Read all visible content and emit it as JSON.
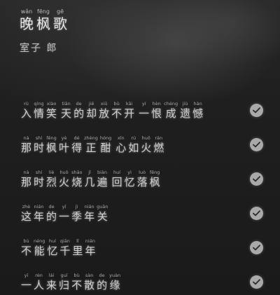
{
  "poem": {
    "title": [
      {
        "py": "wǎn",
        "hz": "晚"
      },
      {
        "py": "fēng",
        "hz": "枫"
      },
      {
        "py": "gē",
        "hz": "歌"
      }
    ],
    "author": "室子 郎",
    "lines": [
      {
        "chars": [
          {
            "py": "rù",
            "hz": "入"
          },
          {
            "py": "qíng",
            "hz": "情"
          },
          {
            "py": "xiào",
            "hz": "笑"
          },
          {
            "py": "",
            "hz": " "
          },
          {
            "py": "tiān",
            "hz": "天"
          },
          {
            "py": "de",
            "hz": "的"
          },
          {
            "py": "jiē",
            "hz": "却"
          },
          {
            "py": "xiū",
            "hz": "放"
          },
          {
            "py": "bù",
            "hz": "不"
          },
          {
            "py": "kāi",
            "hz": "开"
          },
          {
            "py": "",
            "hz": " "
          },
          {
            "py": "yí",
            "hz": "一"
          },
          {
            "py": "hèn",
            "hz": "恨"
          },
          {
            "py": "chéng",
            "hz": "成"
          },
          {
            "py": "jiù",
            "hz": "遗"
          },
          {
            "py": "hàn",
            "hz": "憾"
          }
        ]
      },
      {
        "chars": [
          {
            "py": "nà",
            "hz": "那"
          },
          {
            "py": "shí",
            "hz": "时"
          },
          {
            "py": "fēng",
            "hz": "枫"
          },
          {
            "py": "yè",
            "hz": "叶"
          },
          {
            "py": "dé",
            "hz": "得"
          },
          {
            "py": "zhèng",
            "hz": "正"
          },
          {
            "py": "hóng",
            "hz": "酣"
          },
          {
            "py": "",
            "hz": " "
          },
          {
            "py": "xīn",
            "hz": "心"
          },
          {
            "py": "rú",
            "hz": "如"
          },
          {
            "py": "huǒ",
            "hz": "火"
          },
          {
            "py": "rán",
            "hz": "燃"
          }
        ]
      },
      {
        "chars": [
          {
            "py": "nà",
            "hz": "那"
          },
          {
            "py": "shí",
            "hz": "时"
          },
          {
            "py": "liè",
            "hz": "烈"
          },
          {
            "py": "huǒ",
            "hz": "火"
          },
          {
            "py": "shāo",
            "hz": "烧"
          },
          {
            "py": "jǐ",
            "hz": "几"
          },
          {
            "py": "biàn",
            "hz": "遍"
          },
          {
            "py": "",
            "hz": " "
          },
          {
            "py": "huí",
            "hz": "回"
          },
          {
            "py": "yì",
            "hz": "忆"
          },
          {
            "py": "luò",
            "hz": "落"
          },
          {
            "py": "fēng",
            "hz": "枫"
          }
        ]
      },
      {
        "chars": [
          {
            "py": "zhè",
            "hz": "这"
          },
          {
            "py": "nián",
            "hz": "年"
          },
          {
            "py": "de",
            "hz": "的"
          },
          {
            "py": "yī",
            "hz": "一"
          },
          {
            "py": "jì",
            "hz": "季"
          },
          {
            "py": "nián",
            "hz": "年"
          },
          {
            "py": "guān",
            "hz": "关"
          }
        ]
      },
      {
        "chars": [
          {
            "py": "bù",
            "hz": "不"
          },
          {
            "py": "néng",
            "hz": "能"
          },
          {
            "py": "huí",
            "hz": "忆"
          },
          {
            "py": "qiān",
            "hz": "千"
          },
          {
            "py": "lǐ",
            "hz": "里"
          },
          {
            "py": "nián",
            "hz": "年"
          }
        ]
      },
      {
        "chars": [
          {
            "py": "yī",
            "hz": "一"
          },
          {
            "py": "rén",
            "hz": "人"
          },
          {
            "py": "lái",
            "hz": "来"
          },
          {
            "py": "guī",
            "hz": "归"
          },
          {
            "py": "bù",
            "hz": "不"
          },
          {
            "py": "sàn",
            "hz": "散"
          },
          {
            "py": "de",
            "hz": "的"
          },
          {
            "py": "yuàn",
            "hz": "缘"
          }
        ]
      }
    ]
  },
  "icons": {
    "line_status": "check-circle-icon"
  },
  "colors": {
    "background": "#1f1f1f",
    "text": "#cfcfcf",
    "check_fill": "#a9a9a9",
    "check_mark": "#2a2a2a"
  }
}
